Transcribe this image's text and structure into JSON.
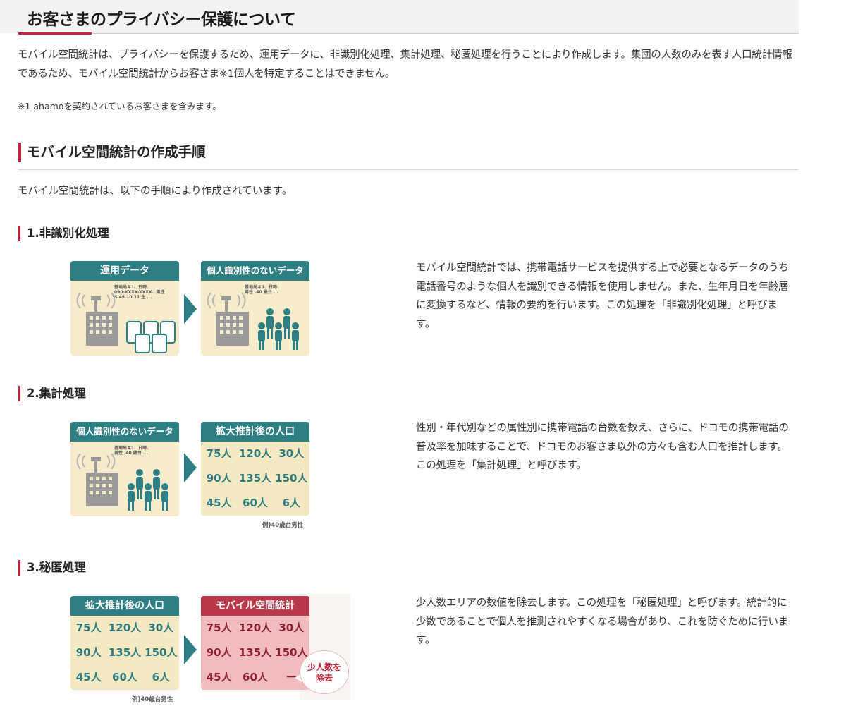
{
  "page": {
    "title": "お客さまのプライバシー保護について",
    "intro": "モバイル空間統計は、プライバシーを保護するため、運用データに、非識別化処理、集計処理、秘匿処理を行うことにより作成します。集団の人数のみを表す人口統計情報であるため、モバイル空間統計からお客さま※1個人を特定することはできません。",
    "note": "※1 ahamoを契約されているお客さまを含みます。"
  },
  "procedure": {
    "heading": "モバイル空間統計の作成手順",
    "intro": "モバイル空間統計は、以下の手順により作成されています。"
  },
  "steps": [
    {
      "heading": "1.非識別化処理",
      "description": "モバイル空間統計では、携帯電話サービスを提供する上で必要となるデータのうち電話番号のような個人を識別できる情報を使用しません。また、生年月日を年齢層に変換するなど、情報の要約を行います。この処理を「非識別化処理」と呼びます。",
      "card_left": {
        "title": "運用データ",
        "caption": "基地局＃1、日時、\n090-XXXX-XXXX、男性\nS.45.10.11 生 ..."
      },
      "card_right": {
        "title": "個人識別性のないデータ",
        "caption": "基地局＃1、日時、\n男性 .40 歳台 ..."
      }
    },
    {
      "heading": "2.集計処理",
      "description": "性別・年代別などの属性別に携帯電話の台数を数え、さらに、ドコモの携帯電話の普及率を加味することで、ドコモのお客さま以外の方々も含む人口を推計します。この処理を「集計処理」と呼びます。",
      "card_left": {
        "title": "個人識別性のないデータ",
        "caption": "基地局＃1、日時、\n男性 .40 歳台 ..."
      },
      "card_right": {
        "title": "拡大推計後の人口",
        "cells": [
          "75人",
          "120人",
          "30人",
          "90人",
          "135人",
          "150人",
          "45人",
          "60人",
          "6人"
        ]
      },
      "example": "例)40歳台男性"
    },
    {
      "heading": "3.秘匿処理",
      "description": "少人数エリアの数値を除去します。この処理を「秘匿処理」と呼びます。統計的に少数であることで個人を推測されやすくなる場合があり、これを防ぐために行います。",
      "card_left": {
        "title": "拡大推計後の人口",
        "cells": [
          "75人",
          "120人",
          "30人",
          "90人",
          "135人",
          "150人",
          "45人",
          "60人",
          "6人"
        ]
      },
      "card_right": {
        "title": "モバイル空間統計",
        "cells": [
          "75人",
          "120人",
          "30人",
          "90人",
          "135人",
          "150人",
          "45人",
          "60人",
          "ー"
        ]
      },
      "example": "例)40歳台男性",
      "bubble": "少人数を\n除去"
    }
  ],
  "colors": {
    "accent": "#c4213a",
    "teal": "#2e7f84",
    "cream": "#f6eccb",
    "pink": "#f0bcc0",
    "red_header": "#b8394a"
  }
}
